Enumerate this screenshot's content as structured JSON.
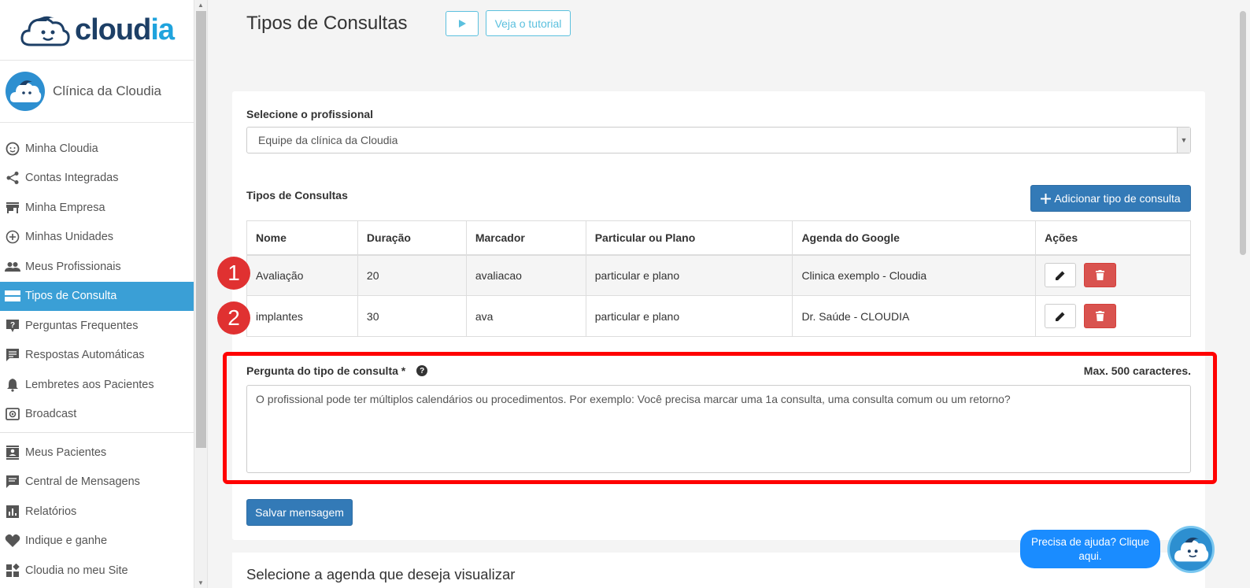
{
  "brand": {
    "logo_main": "cloud",
    "logo_accent": "ia"
  },
  "clinic": {
    "name": "Clínica da Cloudia"
  },
  "nav": [
    {
      "label": "Minha Cloudia",
      "icon": "face-icon"
    },
    {
      "label": "Contas Integradas",
      "icon": "share-icon"
    },
    {
      "label": "Minha Empresa",
      "icon": "store-icon"
    },
    {
      "label": "Minhas Unidades",
      "icon": "plus-circle-icon"
    },
    {
      "label": "Meus Profissionais",
      "icon": "people-icon"
    },
    {
      "label": "Tipos de Consulta",
      "icon": "list-icon"
    },
    {
      "label": "Perguntas Frequentes",
      "icon": "question-icon"
    },
    {
      "label": "Respostas Automáticas",
      "icon": "message-icon"
    },
    {
      "label": "Lembretes aos Pacientes",
      "icon": "bell-icon"
    },
    {
      "label": "Broadcast",
      "icon": "broadcast-icon"
    },
    {
      "label": "Meus Pacientes",
      "icon": "contacts-icon"
    },
    {
      "label": "Central de Mensagens",
      "icon": "chat-icon"
    },
    {
      "label": "Relatórios",
      "icon": "chart-icon"
    },
    {
      "label": "Indique e ganhe",
      "icon": "heart-icon"
    },
    {
      "label": "Cloudia no meu Site",
      "icon": "widgets-icon"
    }
  ],
  "header": {
    "title": "Tipos de Consultas",
    "tutorial_label": "Veja o tutorial"
  },
  "form": {
    "professional_label": "Selecione o profissional",
    "professional_value": "Equipe da clínica da Cloudia",
    "section_title": "Tipos de Consultas",
    "add_button": "Adicionar tipo de consulta"
  },
  "table": {
    "headers": [
      "Nome",
      "Duração",
      "Marcador",
      "Particular ou Plano",
      "Agenda do Google",
      "Ações"
    ],
    "rows": [
      [
        "Avaliação",
        "20",
        "avaliacao",
        "particular e plano",
        "Clinica exemplo - Cloudia"
      ],
      [
        "implantes",
        "30",
        "ava",
        "particular e plano",
        "Dr. Saúde - CLOUDIA"
      ]
    ]
  },
  "markers": [
    "1",
    "2"
  ],
  "question": {
    "label": "Pergunta do tipo de consulta *",
    "help": "?",
    "max": "Max. 500 caracteres.",
    "value": "O profissional pode ter múltiplos calendários ou procedimentos. Por exemplo: Você precisa marcar uma 1a consulta, uma consulta comum ou um retorno?"
  },
  "save_button": "Salvar mensagem",
  "agenda_title": "Selecione a agenda que deseja visualizar",
  "help_chat": "Precisa de ajuda? Clique aqui.",
  "colors": {
    "accent": "#3a9fd6",
    "primary": "#337ab7",
    "danger": "#d9534f",
    "highlight": "#ff0000"
  }
}
